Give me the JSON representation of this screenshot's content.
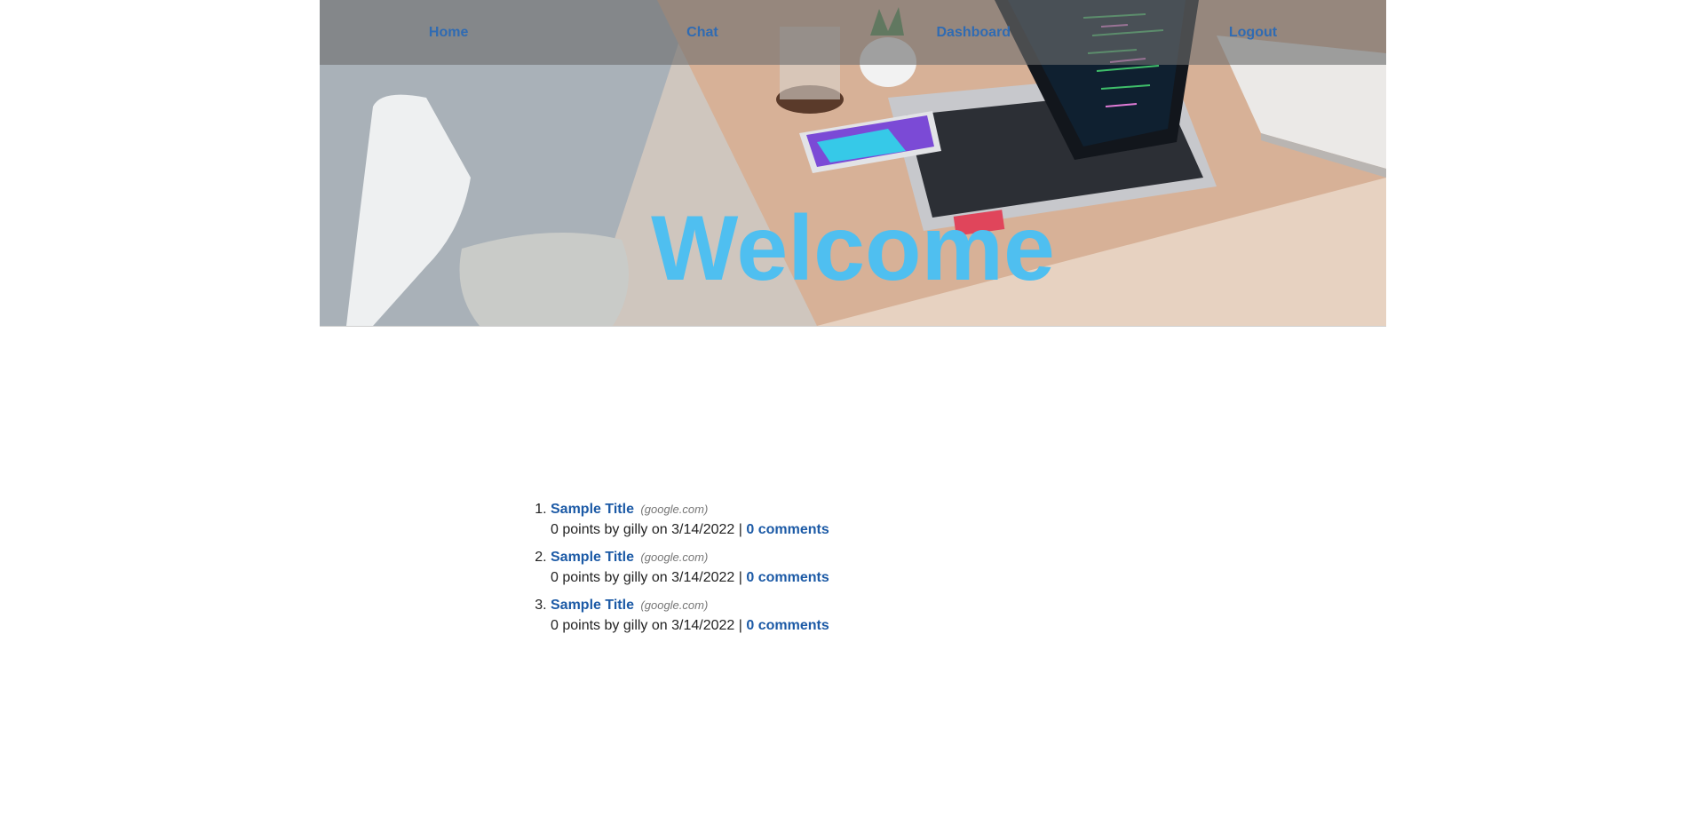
{
  "nav": {
    "items": [
      {
        "label": "Home"
      },
      {
        "label": "Chat"
      },
      {
        "label": "Dashboard"
      },
      {
        "label": "Logout"
      }
    ]
  },
  "hero": {
    "heading": "Welcome"
  },
  "feed": {
    "items": [
      {
        "title": "Sample Title",
        "domain": "(google.com)",
        "points": "0 points",
        "by": "by",
        "author": "gilly",
        "on": "on",
        "date": "3/14/2022",
        "separator": "|",
        "comments": "0 comments"
      },
      {
        "title": "Sample Title",
        "domain": "(google.com)",
        "points": "0 points",
        "by": "by",
        "author": "gilly",
        "on": "on",
        "date": "3/14/2022",
        "separator": "|",
        "comments": "0 comments"
      },
      {
        "title": "Sample Title",
        "domain": "(google.com)",
        "points": "0 points",
        "by": "by",
        "author": "gilly",
        "on": "on",
        "date": "3/14/2022",
        "separator": "|",
        "comments": "0 comments"
      }
    ]
  }
}
